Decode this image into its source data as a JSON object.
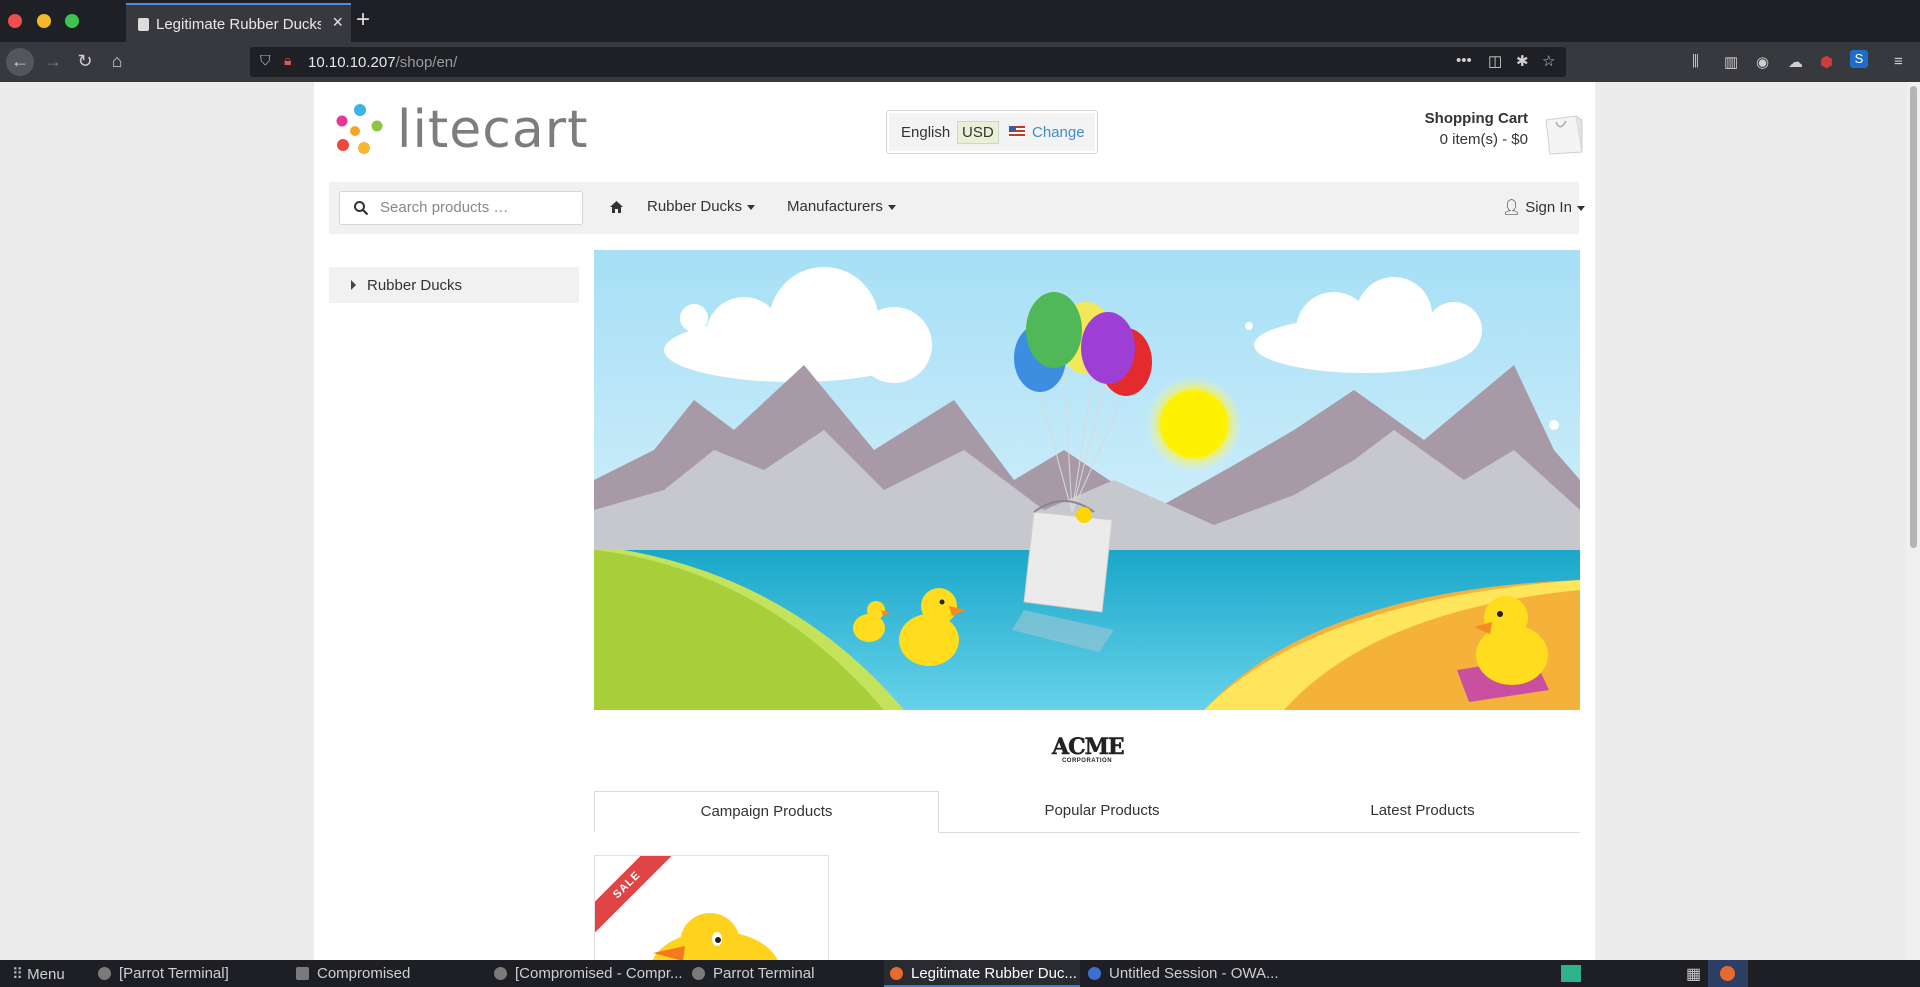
{
  "browser": {
    "tab_title": "Legitimate Rubber Ducks",
    "url_host": "10.10.10.207",
    "url_path": "/shop/en/"
  },
  "header": {
    "logo_text": "litecart",
    "language": "English",
    "currency": "USD",
    "change_label": "Change",
    "cart_title": "Shopping Cart",
    "cart_count": "0 item(s) - $0"
  },
  "menu": {
    "search_placeholder": "Search products …",
    "items": [
      "Rubber Ducks",
      "Manufacturers"
    ],
    "signin_label": "Sign In"
  },
  "sidebar": {
    "categories": [
      "Rubber Ducks"
    ]
  },
  "manufacturer_logo": {
    "line1": "ACME",
    "line2": "CORPORATION"
  },
  "product_tabs": [
    "Campaign Products",
    "Popular Products",
    "Latest Products"
  ],
  "product": {
    "badge": "SALE"
  },
  "taskbar": {
    "items": [
      "Menu",
      "[Parrot Terminal]",
      "Compromised",
      "[Compromised - Compr...",
      "Parrot Terminal",
      "Legitimate Rubber Duc...",
      "Untitled Session - OWA..."
    ]
  },
  "colors": {
    "accent_link": "#3c8fc7",
    "sale_badge": "#e04545",
    "sky": "#aee3f7"
  }
}
